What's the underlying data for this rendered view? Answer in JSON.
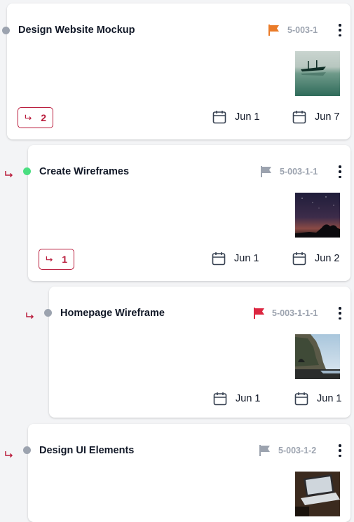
{
  "colors": {
    "accent_red": "#b91c3c",
    "status_gray": "#9ca3af",
    "status_green": "#4ade80",
    "flag_orange": "#ea7b28",
    "flag_gray": "#9ca3af",
    "flag_red": "#dc2640"
  },
  "tasks": [
    {
      "title": "Design Website Mockup",
      "code": "5-003-1",
      "status_color": "gray",
      "flag": "orange-flag-icon",
      "thumbnail": "lake-with-boat-photo",
      "subtask_count": "2",
      "start_date": "Jun 1",
      "end_date": "Jun 7"
    },
    {
      "title": "Create Wireframes",
      "code": "5-003-1-1",
      "status_color": "green",
      "flag": "gray-flag-icon",
      "thumbnail": "night-sky-photo",
      "subtask_count": "1",
      "start_date": "Jun 1",
      "end_date": "Jun 2"
    },
    {
      "title": "Homepage Wireframe",
      "code": "5-003-1-1-1",
      "status_color": "gray",
      "flag": "red-flag-icon",
      "thumbnail": "coastal-cliff-photo",
      "start_date": "Jun 1",
      "end_date": "Jun 1"
    },
    {
      "title": "Design UI Elements",
      "code": "5-003-1-2",
      "status_color": "gray",
      "flag": "gray-flag-icon",
      "thumbnail": "laptop-on-desk-photo"
    }
  ]
}
